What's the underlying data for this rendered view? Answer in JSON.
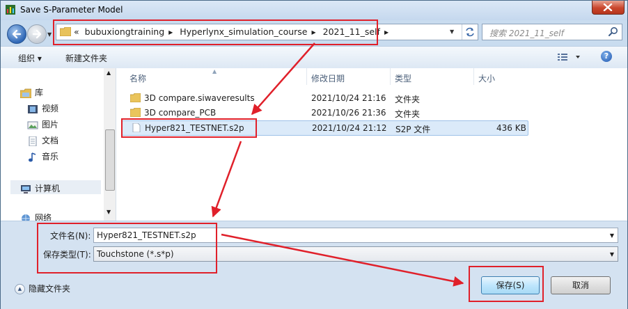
{
  "window": {
    "title": "Save S-Parameter Model"
  },
  "address": {
    "crumb_prefix": "«",
    "crumbs": [
      "bubuxiongtraining",
      "Hyperlynx_simulation_course",
      "2021_11_self"
    ]
  },
  "search": {
    "placeholder": "搜索 2021_11_self"
  },
  "toolbar": {
    "organize": "组织 ▾",
    "new_folder": "新建文件夹"
  },
  "nav": {
    "library": "库",
    "videos": "视频",
    "pictures": "图片",
    "documents": "文档",
    "music": "音乐",
    "computer": "计算机",
    "network": "网络"
  },
  "columns": {
    "name": "名称",
    "modified": "修改日期",
    "type": "类型",
    "size": "大小"
  },
  "files": [
    {
      "name": "3D compare.siwaveresults",
      "modified": "2021/10/24 21:16",
      "type": "文件夹",
      "size": ""
    },
    {
      "name": "3D compare_PCB",
      "modified": "2021/10/26 21:36",
      "type": "文件夹",
      "size": ""
    },
    {
      "name": "Hyper821_TESTNET.s2p",
      "modified": "2021/10/24 21:12",
      "type": "S2P 文件",
      "size": "436 KB"
    }
  ],
  "filename": {
    "label": "文件名(N):",
    "value": "Hyper821_TESTNET.s2p"
  },
  "filetype": {
    "label": "保存类型(T):",
    "value": "Touchstone (*.s*p)"
  },
  "hide_folders": "隐藏文件夹",
  "buttons": {
    "save": "保存(S)",
    "cancel": "取消"
  },
  "colors": {
    "annotation": "#e0202a",
    "selection": "#dbeaf9",
    "chrome": "#c9dcef"
  }
}
